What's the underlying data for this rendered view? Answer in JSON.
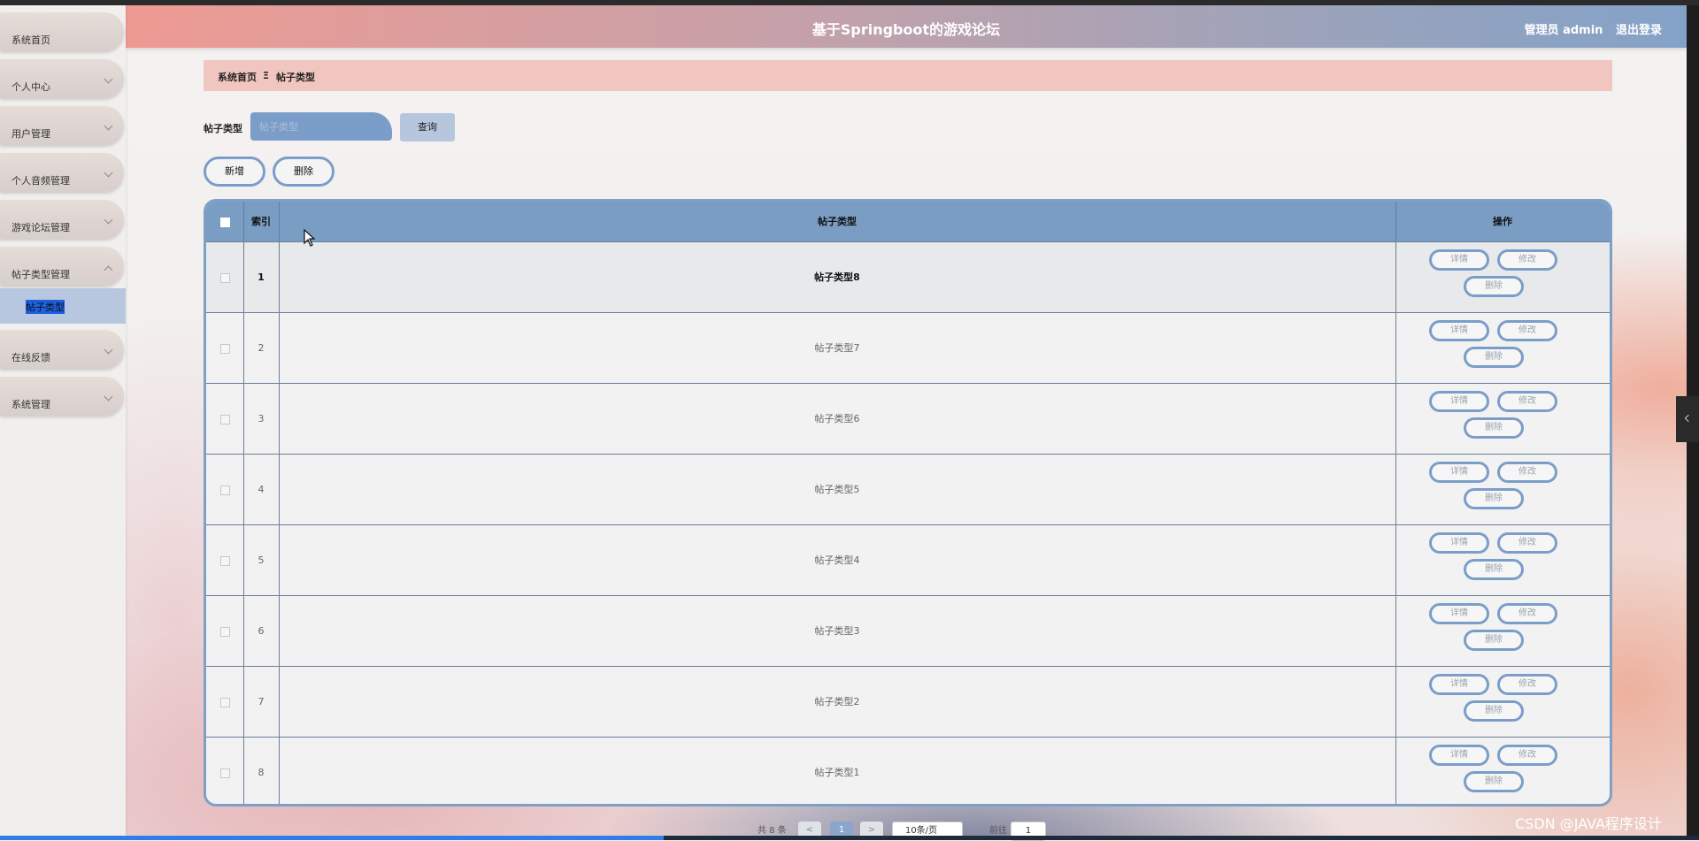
{
  "app": {
    "title": "基于Springboot的游戏论坛"
  },
  "header": {
    "user_label": "管理员 admin",
    "logout_label": "退出登录"
  },
  "sidebar": {
    "items": [
      {
        "label": "系统首页",
        "expandable": false
      },
      {
        "label": "个人中心",
        "expandable": true
      },
      {
        "label": "用户管理",
        "expandable": true
      },
      {
        "label": "个人音频管理",
        "expandable": true
      },
      {
        "label": "游戏论坛管理",
        "expandable": true
      },
      {
        "label": "帖子类型管理",
        "expandable": true,
        "expanded": true
      },
      {
        "label": "在线反馈",
        "expandable": true
      },
      {
        "label": "系统管理",
        "expandable": true
      }
    ],
    "active_sub_item": "帖子类型"
  },
  "breadcrumb": {
    "home": "系统首页",
    "separator": "Ξ",
    "current": "帖子类型"
  },
  "search": {
    "label": "帖子类型",
    "placeholder": "帖子类型",
    "value": "",
    "button": "查询"
  },
  "toolbar": {
    "add_label": "新增",
    "delete_label": "删除"
  },
  "table": {
    "columns": {
      "index": "索引",
      "type": "帖子类型",
      "actions": "操作"
    },
    "row_actions": {
      "detail": "详情",
      "edit": "修改",
      "delete": "删除"
    },
    "rows": [
      {
        "index": "1",
        "type": "帖子类型8"
      },
      {
        "index": "2",
        "type": "帖子类型7"
      },
      {
        "index": "3",
        "type": "帖子类型6"
      },
      {
        "index": "4",
        "type": "帖子类型5"
      },
      {
        "index": "5",
        "type": "帖子类型4"
      },
      {
        "index": "6",
        "type": "帖子类型3"
      },
      {
        "index": "7",
        "type": "帖子类型2"
      },
      {
        "index": "8",
        "type": "帖子类型1"
      }
    ]
  },
  "pagination": {
    "total_text": "共 8 条",
    "prev": "<",
    "page": "1",
    "next": ">",
    "page_size": "10条/页",
    "goto_label": "前往",
    "goto_value": "1"
  },
  "watermark": "CSDN @JAVA程序设计",
  "colors": {
    "accent": "#7b9dc9",
    "header_start": "#ee9a92",
    "header_end": "#84a2c8",
    "breadcrumb_bg": "#f2c6c0"
  }
}
